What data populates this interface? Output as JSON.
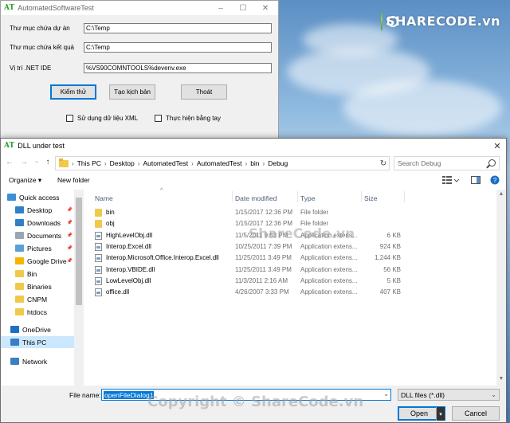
{
  "desktop": {
    "logo_text": "SHARECODE.vn"
  },
  "form": {
    "icon": "AT",
    "title": "AutomatedSoftwareTest",
    "controls": [
      "–",
      "☐",
      "✕"
    ],
    "fields": [
      {
        "label": "Thư mục chứa dự án",
        "value": "C:\\Temp"
      },
      {
        "label": "Thư mục chứa kết quả",
        "value": "C:\\Temp"
      },
      {
        "label": "Vị trí .NET IDE",
        "value": "%VS90COMNTOOLS%devenv.exe"
      }
    ],
    "buttons": {
      "test": "Kiểm thử",
      "script": "Tạo kịch bản",
      "exit": "Thoát"
    },
    "checks": {
      "xml": "Sử dụng dữ liệu XML",
      "manual": "Thực hiện bằng tay"
    }
  },
  "dialog": {
    "icon": "AT",
    "title": "DLL under test",
    "close": "✕",
    "breadcrumb": [
      "This PC",
      "Desktop",
      "AutomatedTest",
      "AutomatedTest",
      "bin",
      "Debug"
    ],
    "search_placeholder": "Search Debug",
    "organize": "Organize ▾",
    "new_folder": "New folder",
    "nav": [
      {
        "label": "Quick access",
        "icon": "star-icon",
        "color": "#3c8fd6",
        "pinned": false,
        "selected": false
      },
      {
        "label": "Desktop",
        "icon": "desktop-icon",
        "color": "#2f80c8",
        "pinned": true,
        "selected": false
      },
      {
        "label": "Downloads",
        "icon": "download-icon",
        "color": "#2f80c8",
        "pinned": true,
        "selected": false
      },
      {
        "label": "Documents",
        "icon": "documents-icon",
        "color": "#9aa6b2",
        "pinned": true,
        "selected": false
      },
      {
        "label": "Pictures",
        "icon": "pictures-icon",
        "color": "#5aa0d8",
        "pinned": true,
        "selected": false
      },
      {
        "label": "Google Drive",
        "icon": "google-drive-icon",
        "color": "#f4b400",
        "pinned": true,
        "selected": false
      },
      {
        "label": "Bin",
        "icon": "folder-icon",
        "color": "#f0c94a",
        "pinned": false,
        "selected": false
      },
      {
        "label": "Binaries",
        "icon": "folder-icon",
        "color": "#f0c94a",
        "pinned": false,
        "selected": false
      },
      {
        "label": "CNPM",
        "icon": "folder-icon",
        "color": "#f0c94a",
        "pinned": false,
        "selected": false
      },
      {
        "label": "htdocs",
        "icon": "folder-icon",
        "color": "#f0c94a",
        "pinned": false,
        "selected": false
      },
      {
        "label": "OneDrive",
        "icon": "onedrive-icon",
        "color": "#1f6fc4",
        "pinned": false,
        "selected": false
      },
      {
        "label": "This PC",
        "icon": "computer-icon",
        "color": "#3a7fc4",
        "pinned": false,
        "selected": true
      },
      {
        "label": "Network",
        "icon": "network-icon",
        "color": "#3a7fc4",
        "pinned": false,
        "selected": false
      }
    ],
    "columns": {
      "name": "Name",
      "date": "Date modified",
      "type": "Type",
      "size": "Size"
    },
    "files": [
      {
        "name": "bin",
        "date": "1/15/2017 12:36 PM",
        "type": "File folder",
        "size": "",
        "kind": "folder"
      },
      {
        "name": "obj",
        "date": "1/15/2017 12:36 PM",
        "type": "File folder",
        "size": "",
        "kind": "folder"
      },
      {
        "name": "HighLevelObj.dll",
        "date": "11/5/2011 9:53 PM",
        "type": "Application extens...",
        "size": "6 KB",
        "kind": "dll"
      },
      {
        "name": "Interop.Excel.dll",
        "date": "10/25/2011 7:39 PM",
        "type": "Application extens...",
        "size": "924 KB",
        "kind": "dll"
      },
      {
        "name": "Interop.Microsoft.Office.Interop.Excel.dll",
        "date": "11/25/2011 3:49 PM",
        "type": "Application extens...",
        "size": "1,244 KB",
        "kind": "dll"
      },
      {
        "name": "Interop.VBIDE.dll",
        "date": "11/25/2011 3:49 PM",
        "type": "Application extens...",
        "size": "56 KB",
        "kind": "dll"
      },
      {
        "name": "LowLevelObj.dll",
        "date": "11/3/2011 2:16 AM",
        "type": "Application extens...",
        "size": "5 KB",
        "kind": "dll"
      },
      {
        "name": "office.dll",
        "date": "4/26/2007 3:33 PM",
        "type": "Application extens...",
        "size": "407 KB",
        "kind": "dll"
      }
    ],
    "file_name_label": "File name:",
    "file_name_value": "openFileDialog1",
    "file_type": "DLL files (*.dll)",
    "open": "Open",
    "cancel": "Cancel"
  },
  "watermarks": {
    "center": "ShareCode.vn",
    "bottom": "Copyright © ShareCode.vn"
  }
}
